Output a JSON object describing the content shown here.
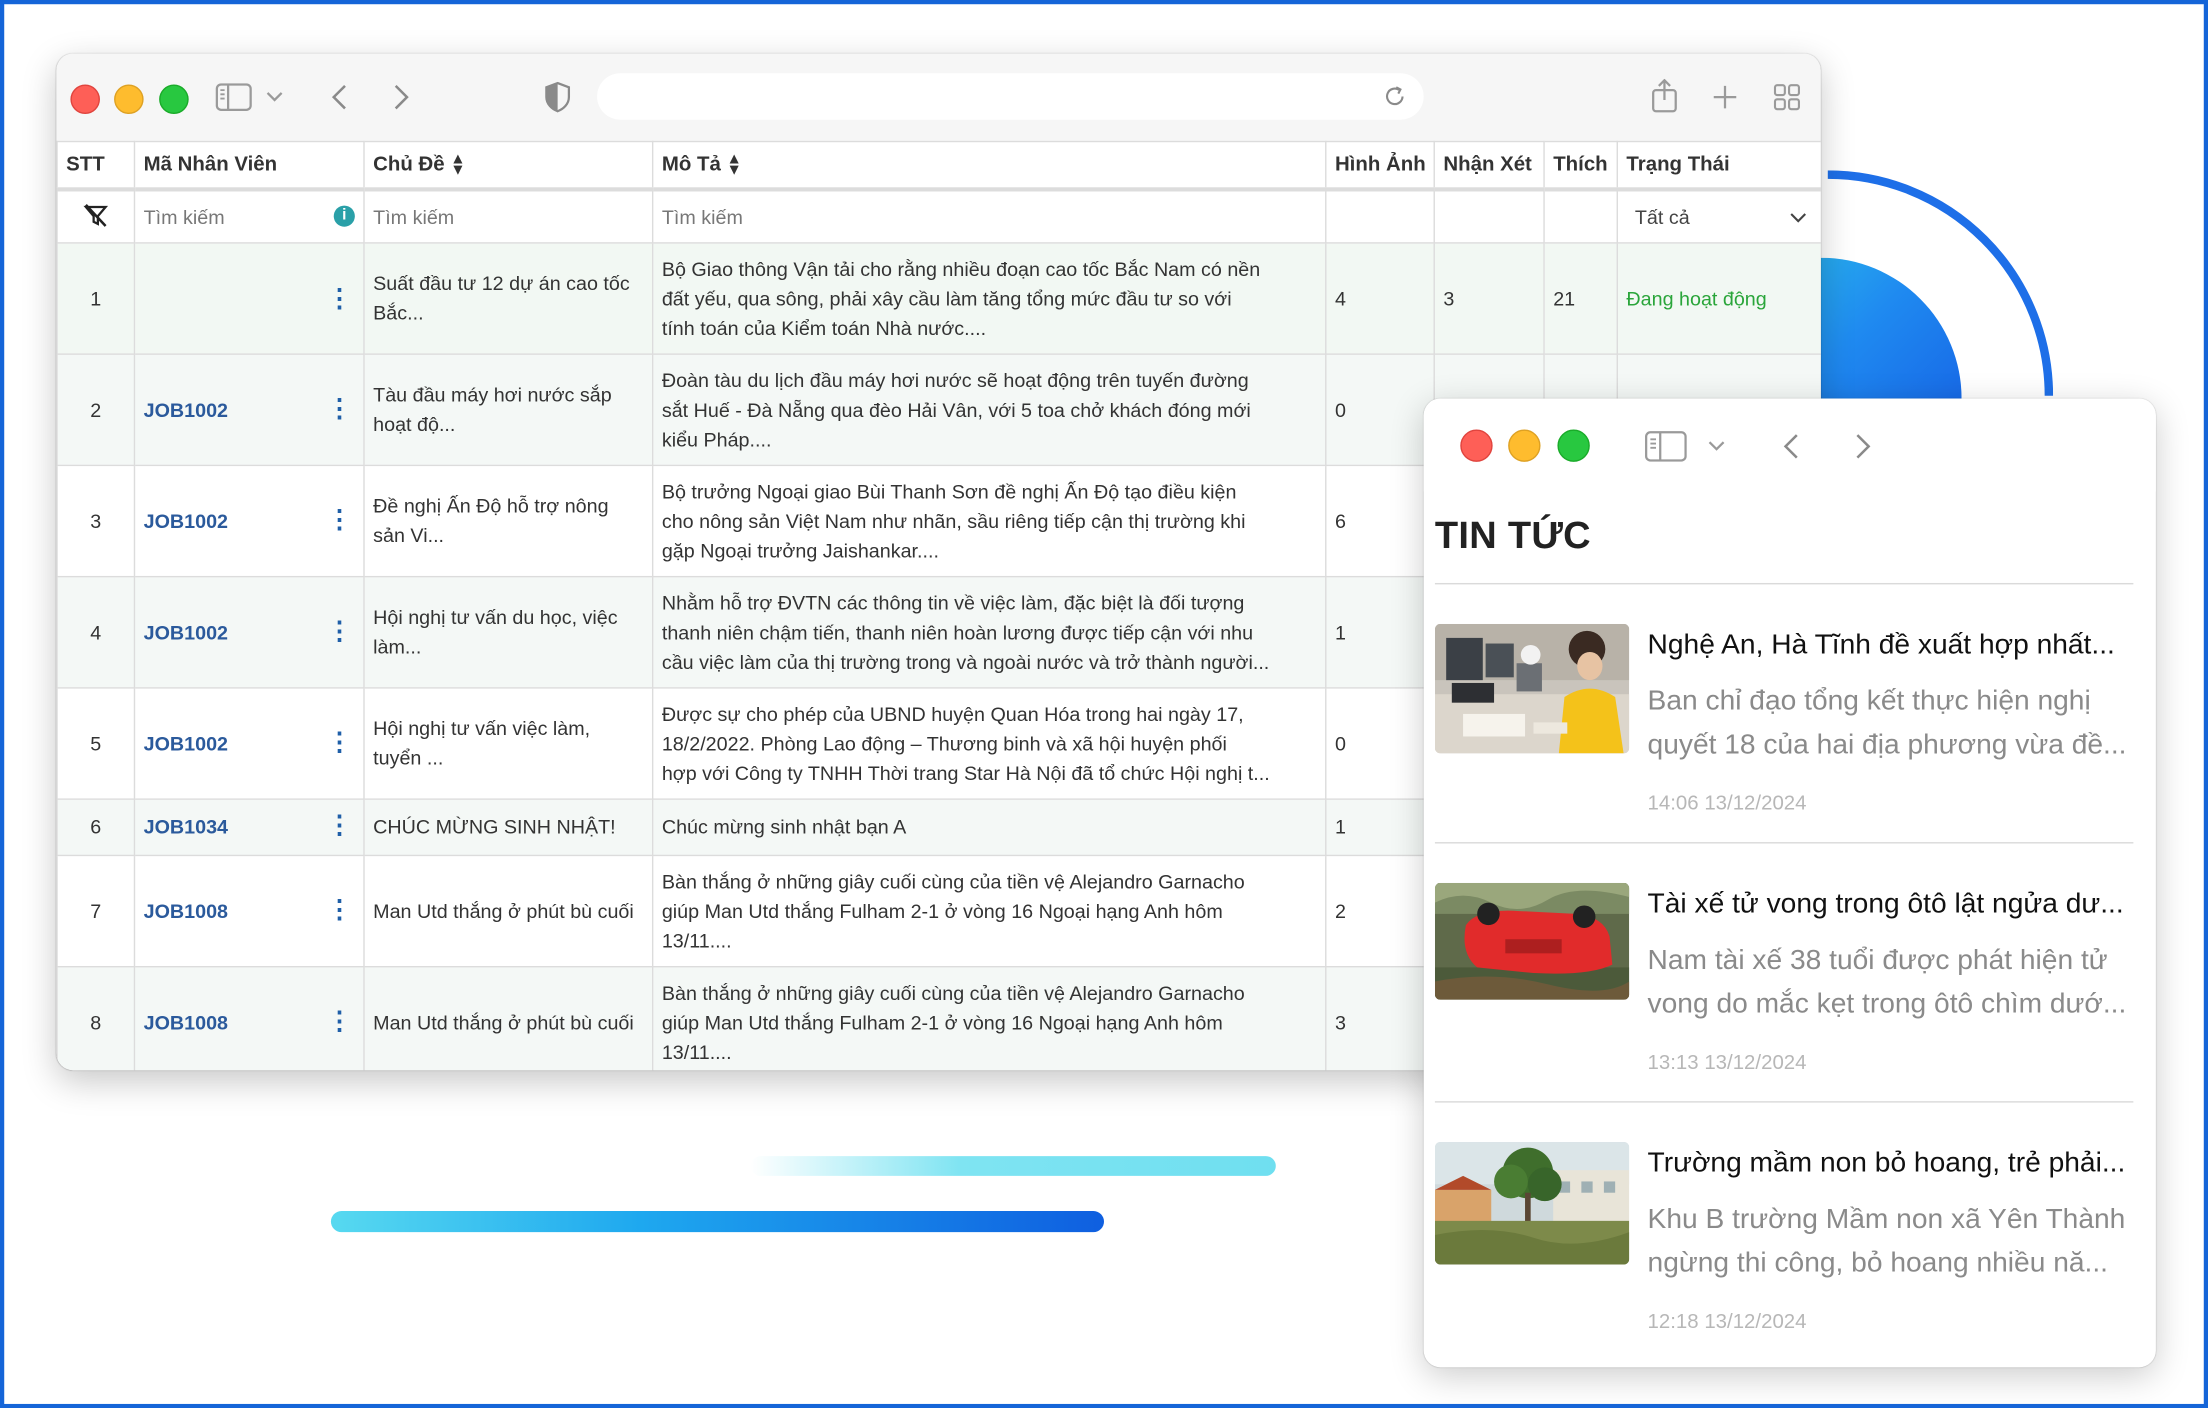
{
  "table": {
    "columns": {
      "stt": "STT",
      "employee_code": "Mã Nhân Viên",
      "topic": "Chủ Đề",
      "description": "Mô Tả",
      "images": "Hình Ảnh",
      "comments": "Nhận Xét",
      "likes": "Thích",
      "status": "Trạng Thái"
    },
    "filters": {
      "employee_code_placeholder": "Tìm kiếm",
      "topic_placeholder": "Tìm kiếm",
      "description_placeholder": "Tìm kiếm",
      "status_value": "Tất cả"
    },
    "rows": [
      {
        "stt": "1",
        "code": "",
        "topic": "Suất đầu tư 12 dự án cao tốc Bắc...",
        "desc": [
          "Bộ Giao thông Vận tải cho rằng nhiều đoạn cao tốc Bắc Nam có nền",
          "đất yếu, qua sông, phải xây cầu làm tăng tổng mức đầu tư so với",
          "tính toán của Kiểm toán Nhà nước...."
        ],
        "images": "4",
        "comments": "3",
        "likes": "21",
        "status": "Đang hoạt động"
      },
      {
        "stt": "2",
        "code": "JOB1002",
        "topic": "Tàu đầu máy hơi nước sắp hoạt độ...",
        "desc": [
          "Đoàn tàu du lịch đầu máy hơi nước sẽ hoạt động trên tuyến đường",
          "sắt Huế - Đà Nẵng qua đèo Hải Vân, với 5 toa chở khách đóng mới",
          "kiểu Pháp...."
        ],
        "images": "0",
        "comments": "",
        "likes": "",
        "status": ""
      },
      {
        "stt": "3",
        "code": "JOB1002",
        "topic": "Đề nghị Ấn Độ hỗ trợ nông sản Vi...",
        "desc": [
          "Bộ trưởng Ngoại giao Bùi Thanh Sơn đề nghị Ấn Độ tạo điều kiện",
          "cho nông sản Việt Nam như nhãn, sầu riêng tiếp cận thị trường khi",
          "gặp Ngoại trưởng Jaishankar...."
        ],
        "images": "6",
        "comments": "",
        "likes": "",
        "status": ""
      },
      {
        "stt": "4",
        "code": "JOB1002",
        "topic": "Hội nghị tư vấn du học, việc làm...",
        "desc": [
          "Nhằm hỗ trợ ĐVTN các thông tin về việc làm, đặc biệt là đối tượng",
          "thanh niên chậm tiến, thanh niên hoàn lương được tiếp cận với nhu",
          "cầu việc làm của thị trường trong và ngoài nước và trở thành người..."
        ],
        "images": "1",
        "comments": "",
        "likes": "",
        "status": ""
      },
      {
        "stt": "5",
        "code": "JOB1002",
        "topic": "Hội nghị tư vấn việc làm, tuyển ...",
        "desc": [
          "Được sự cho phép của UBND huyện Quan Hóa trong hai ngày 17,",
          "18/2/2022. Phòng Lao động – Thương binh và xã hội huyện phối",
          "hợp với Công ty TNHH Thời trang Star Hà Nội đã tổ chức Hội nghị t..."
        ],
        "images": "0",
        "comments": "",
        "likes": "",
        "status": ""
      },
      {
        "stt": "6",
        "code": "JOB1034",
        "topic": "CHÚC MỪNG SINH NHẬT!",
        "desc": [
          "Chúc mừng sinh nhật bạn A"
        ],
        "images": "1",
        "comments": "",
        "likes": "",
        "status": ""
      },
      {
        "stt": "7",
        "code": "JOB1008",
        "topic": "Man Utd thắng ở phút bù cuối",
        "desc": [
          "Bàn thắng ở những giây cuối cùng của tiền vệ Alejandro Garnacho",
          "giúp Man Utd thắng Fulham 2-1 ở vòng 16 Ngoại hạng Anh hôm",
          "13/11...."
        ],
        "images": "2",
        "comments": "",
        "likes": "",
        "status": ""
      },
      {
        "stt": "8",
        "code": "JOB1008",
        "topic": "Man Utd thắng ở phút bù cuối",
        "desc": [
          "Bàn thắng ở những giây cuối cùng của tiền vệ Alejandro Garnacho",
          "giúp Man Utd thắng Fulham 2-1 ở vòng 16 Ngoại hạng Anh hôm",
          "13/11...."
        ],
        "images": "3",
        "comments": "",
        "likes": "",
        "status": ""
      }
    ]
  },
  "news": {
    "heading": "TIN TỨC",
    "articles": [
      {
        "title": "Nghệ An, Hà Tĩnh đề xuất hợp nhất...",
        "desc": [
          "Ban chỉ đạo tổng kết thực hiện nghị",
          "quyết 18 của hai địa phương vừa đề..."
        ],
        "time": "14:06 13/12/2024"
      },
      {
        "title": "Tài xế tử vong trong ôtô lật ngửa dư...",
        "desc": [
          "Nam tài xế 38 tuổi được phát hiện tử",
          "vong do mắc kẹt trong ôtô chìm dướ..."
        ],
        "time": "13:13 13/12/2024"
      },
      {
        "title": "Trường mầm non bỏ hoang, trẻ phải...",
        "desc": [
          "Khu B trường Mầm non xã Yên Thành",
          "ngừng thi công, bỏ hoang nhiều nă..."
        ],
        "time": "12:18 13/12/2024"
      }
    ]
  },
  "colors": {
    "accent": "#1565d8",
    "job_code": "#2b5a9c",
    "status_active": "#2aa53a"
  }
}
